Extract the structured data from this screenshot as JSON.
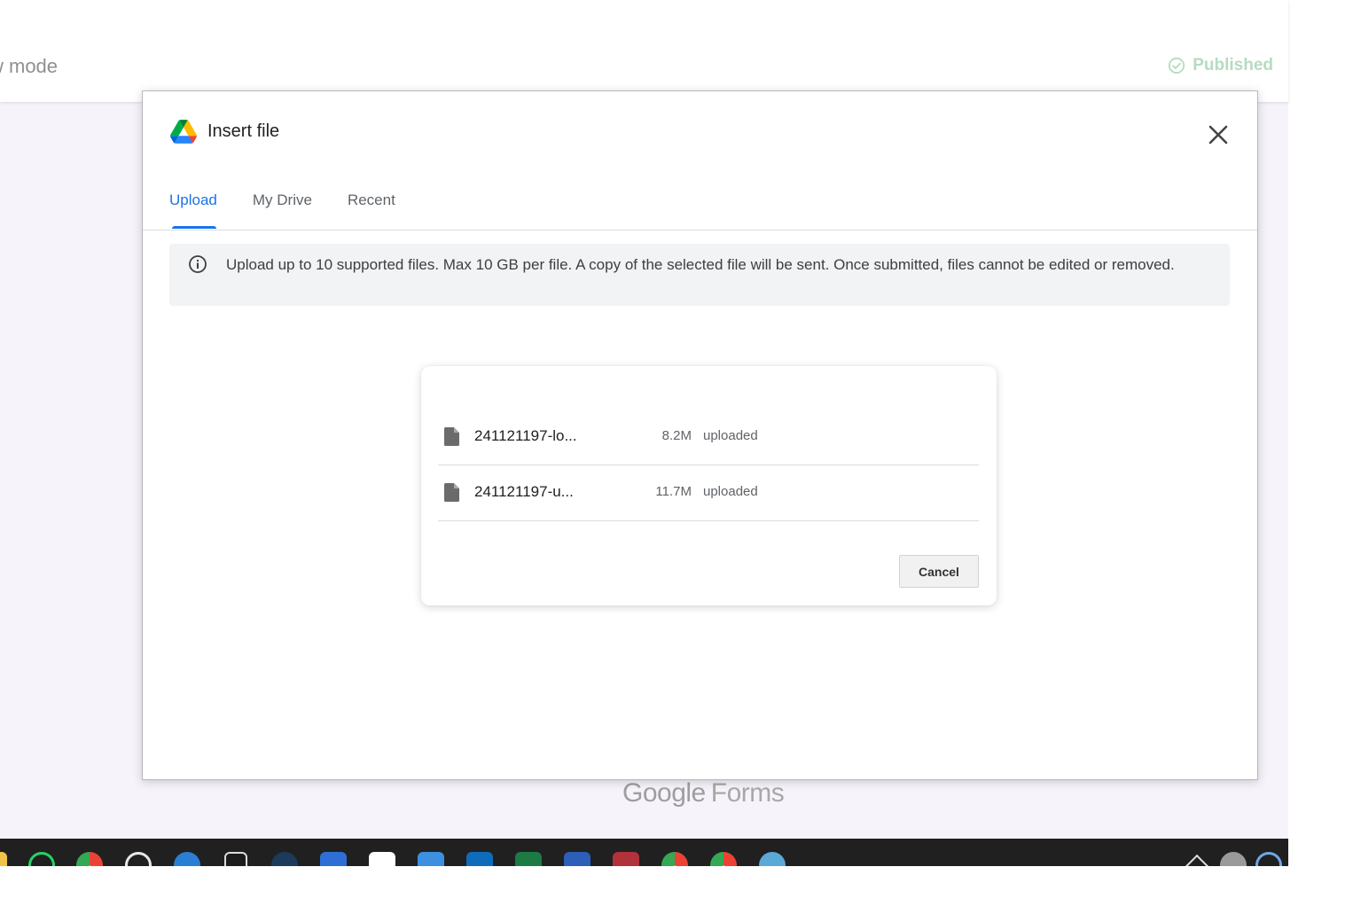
{
  "header": {
    "mode_text": "w mode",
    "status_label": "Published"
  },
  "dialog": {
    "title": "Insert file",
    "tabs": [
      {
        "label": "Upload",
        "active": true
      },
      {
        "label": "My Drive",
        "active": false
      },
      {
        "label": "Recent",
        "active": false
      }
    ],
    "info_text": "Upload up to 10 supported files. Max 10 GB per file. A copy of the selected file will be sent. Once submitted, files cannot be edited or removed.",
    "files": [
      {
        "name": "241121197-lo...",
        "size": "8.2M",
        "status": "uploaded"
      },
      {
        "name": "241121197-u...",
        "size": "11.7M",
        "status": "uploaded"
      }
    ],
    "cancel_label": "Cancel"
  },
  "footer": {
    "brand_google": "Google",
    "brand_product": "Forms"
  },
  "taskbar": {
    "icons": [
      "folder-icon",
      "whatsapp-icon",
      "chrome-icon",
      "lock-app-icon",
      "network-icon",
      "epic-games-icon",
      "steam-icon",
      "c-app-icon",
      "sailboat-app-icon",
      "sailboat-app-2-icon",
      "outlook-icon",
      "excel-icon",
      "word-icon",
      "access-icon",
      "chrome-profile-w-icon",
      "chrome-profile-w2-icon",
      "globe-icon",
      "chevron-up-icon",
      "cloud-icon",
      "settings-icon"
    ]
  },
  "colors": {
    "accent": "#1a73e8",
    "published": "#b4dcbf",
    "taskbar": "#202020"
  }
}
